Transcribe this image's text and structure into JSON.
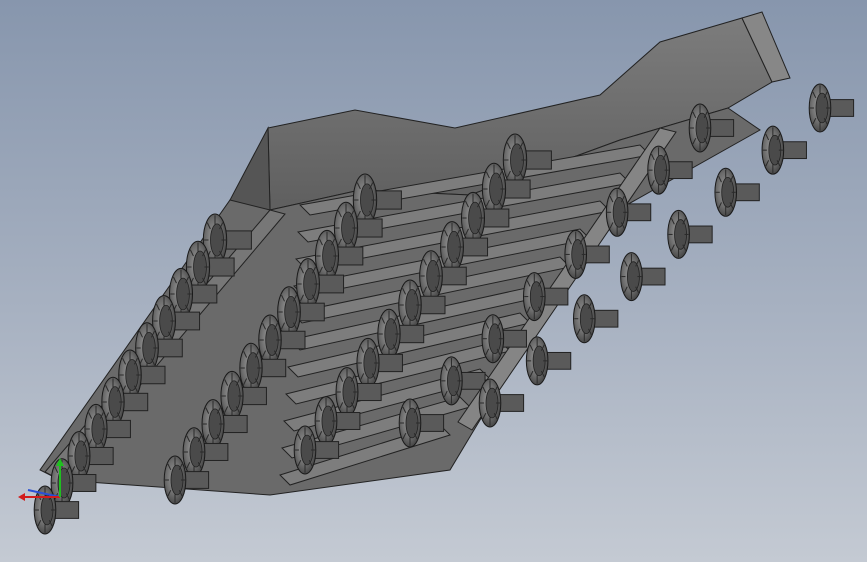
{
  "viewport": {
    "background_top": "#8796ad",
    "background_bottom": "#c4cad3"
  },
  "model": {
    "body_color": "#6e6e6e",
    "face_light": "#8a8a8a",
    "face_dark": "#4f4f4f",
    "edge_color": "#222222",
    "rows": 11,
    "valves_per_row": 3
  },
  "triad": {
    "x_axis_color": "#d21c1c",
    "y_axis_color": "#1fbf1f",
    "z_axis_color": "#2a4fd6"
  }
}
